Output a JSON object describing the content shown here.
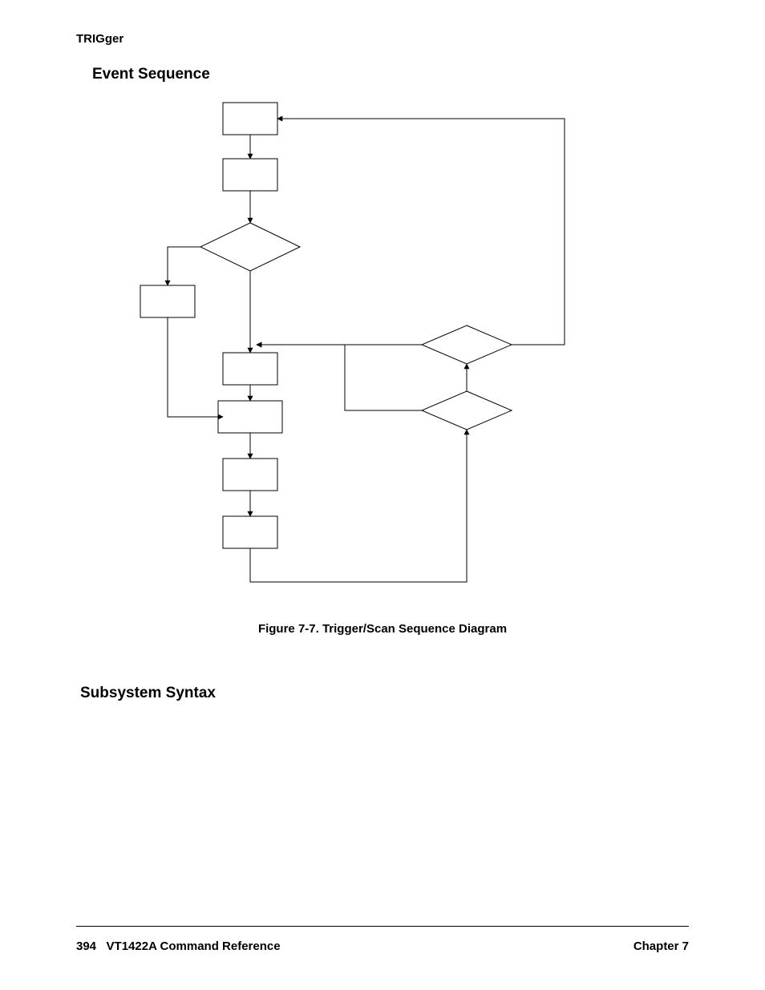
{
  "header": {
    "label": "TRIGger"
  },
  "sections": {
    "eventSequence": "Event Sequence",
    "subsystemSyntax": "Subsystem Syntax"
  },
  "figure": {
    "caption": "Figure 7-7. Trigger/Scan Sequence Diagram"
  },
  "footer": {
    "pageNumber": "394",
    "docTitle": "VT1422A Command Reference",
    "chapter": "Chapter 7"
  },
  "diagram": {
    "shapes": [
      {
        "kind": "rect",
        "name": "box-1"
      },
      {
        "kind": "rect",
        "name": "box-2"
      },
      {
        "kind": "diamond",
        "name": "decision-1"
      },
      {
        "kind": "rect",
        "name": "box-left"
      },
      {
        "kind": "rect",
        "name": "box-3"
      },
      {
        "kind": "rect",
        "name": "box-4"
      },
      {
        "kind": "rect",
        "name": "box-5"
      },
      {
        "kind": "rect",
        "name": "box-6"
      },
      {
        "kind": "diamond",
        "name": "decision-2"
      },
      {
        "kind": "diamond",
        "name": "decision-3"
      }
    ]
  }
}
